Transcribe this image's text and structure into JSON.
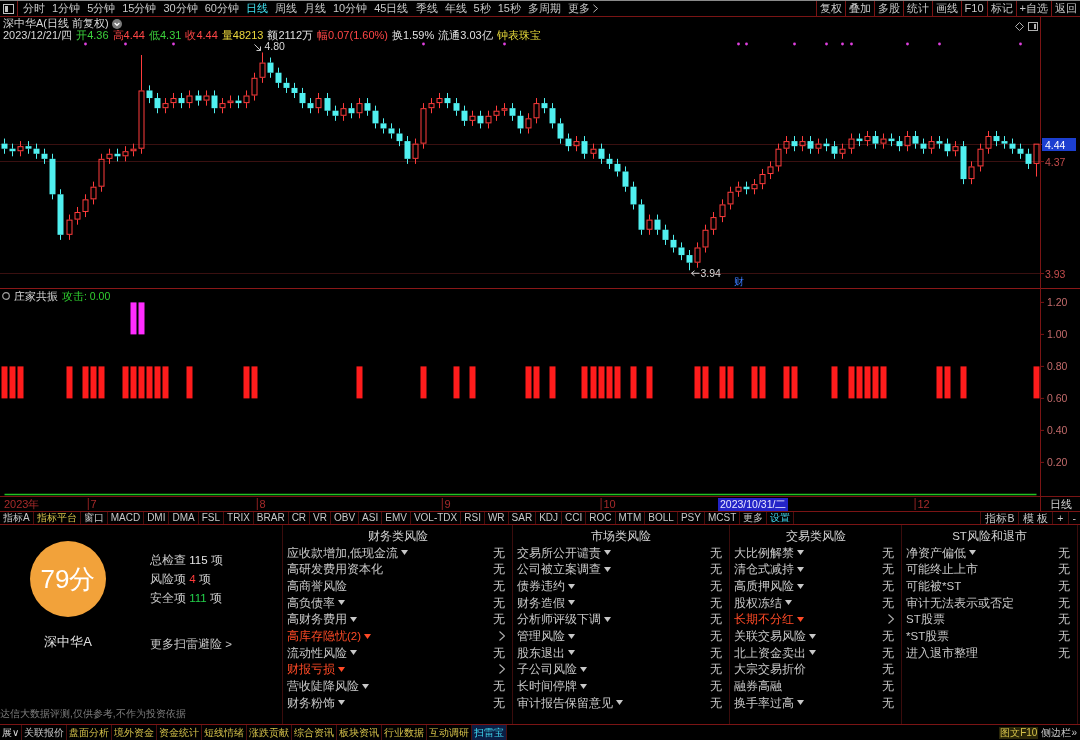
{
  "toolbar": {
    "periods": [
      {
        "label": "分时",
        "selected": false
      },
      {
        "label": "1分钟",
        "selected": false
      },
      {
        "label": "5分钟",
        "selected": false
      },
      {
        "label": "15分钟",
        "selected": false
      },
      {
        "label": "30分钟",
        "selected": false
      },
      {
        "label": "60分钟",
        "selected": false
      },
      {
        "label": "日线",
        "selected": true
      },
      {
        "label": "周线",
        "selected": false
      },
      {
        "label": "月线",
        "selected": false
      },
      {
        "label": "10分钟",
        "selected": false
      },
      {
        "label": "45日线",
        "selected": false
      },
      {
        "label": "季线",
        "selected": false
      },
      {
        "label": "年线",
        "selected": false
      },
      {
        "label": "5秒",
        "selected": false
      },
      {
        "label": "15秒",
        "selected": false
      },
      {
        "label": "多周期",
        "selected": false
      }
    ],
    "more": "更多",
    "actions": [
      "复权",
      "叠加",
      "多股",
      "统计",
      "画线",
      "F10",
      "标记",
      "+自选",
      "返回"
    ]
  },
  "quote_header": {
    "title": "深中华A(日线 前复权)",
    "date": "2023/12/21/四",
    "fields": [
      {
        "label": "开4.36",
        "kind": "down"
      },
      {
        "label": "高4.44",
        "kind": "up"
      },
      {
        "label": "低4.31",
        "kind": "down"
      },
      {
        "label": "收4.44",
        "kind": "up"
      },
      {
        "label": "量48213",
        "kind": "volume"
      },
      {
        "label": "额2112万",
        "kind": "flat"
      },
      {
        "label": "幅0.07(1.60%)",
        "kind": "up"
      },
      {
        "label": "换1.59%",
        "kind": "flat"
      },
      {
        "label": "流通3.03亿",
        "kind": "flat"
      },
      {
        "label": "钟表珠宝",
        "kind": "sector"
      }
    ]
  },
  "price_chart": {
    "chart_data": [
      {
        "type": "candlestick",
        "ohlc": [
          [
            4.44,
            4.46,
            4.4,
            4.42
          ],
          [
            4.42,
            4.44,
            4.39,
            4.41
          ],
          [
            4.41,
            4.45,
            4.39,
            4.43
          ],
          [
            4.43,
            4.45,
            4.4,
            4.42
          ],
          [
            4.42,
            4.44,
            4.38,
            4.4
          ],
          [
            4.4,
            4.42,
            4.36,
            4.38
          ],
          [
            4.38,
            4.4,
            4.22,
            4.24
          ],
          [
            4.24,
            4.26,
            4.06,
            4.08
          ],
          [
            4.08,
            4.16,
            4.06,
            4.14
          ],
          [
            4.14,
            4.19,
            4.12,
            4.17
          ],
          [
            4.17,
            4.24,
            4.15,
            4.22
          ],
          [
            4.22,
            4.29,
            4.2,
            4.27
          ],
          [
            4.27,
            4.4,
            4.25,
            4.38
          ],
          [
            4.38,
            4.42,
            4.36,
            4.4
          ],
          [
            4.4,
            4.42,
            4.37,
            4.39
          ],
          [
            4.39,
            4.43,
            4.37,
            4.41
          ],
          [
            4.41,
            4.44,
            4.39,
            4.42
          ],
          [
            4.42,
            4.79,
            4.4,
            4.65
          ],
          [
            4.65,
            4.67,
            4.6,
            4.62
          ],
          [
            4.62,
            4.64,
            4.56,
            4.58
          ],
          [
            4.58,
            4.62,
            4.56,
            4.6
          ],
          [
            4.6,
            4.64,
            4.58,
            4.62
          ],
          [
            4.62,
            4.64,
            4.58,
            4.6
          ],
          [
            4.6,
            4.65,
            4.58,
            4.63
          ],
          [
            4.63,
            4.65,
            4.59,
            4.61
          ],
          [
            4.61,
            4.65,
            4.59,
            4.63
          ],
          [
            4.63,
            4.65,
            4.56,
            4.58
          ],
          [
            4.58,
            4.62,
            4.56,
            4.6
          ],
          [
            4.6,
            4.63,
            4.58,
            4.61
          ],
          [
            4.61,
            4.63,
            4.58,
            4.6
          ],
          [
            4.6,
            4.65,
            4.58,
            4.63
          ],
          [
            4.63,
            4.72,
            4.61,
            4.7
          ],
          [
            4.7,
            4.8,
            4.68,
            4.76
          ],
          [
            4.76,
            4.78,
            4.7,
            4.72
          ],
          [
            4.72,
            4.74,
            4.66,
            4.68
          ],
          [
            4.68,
            4.7,
            4.64,
            4.66
          ],
          [
            4.66,
            4.68,
            4.62,
            4.64
          ],
          [
            4.64,
            4.66,
            4.58,
            4.6
          ],
          [
            4.6,
            4.62,
            4.56,
            4.58
          ],
          [
            4.58,
            4.64,
            4.56,
            4.62
          ],
          [
            4.62,
            4.64,
            4.55,
            4.57
          ],
          [
            4.57,
            4.59,
            4.53,
            4.55
          ],
          [
            4.55,
            4.6,
            4.53,
            4.58
          ],
          [
            4.58,
            4.6,
            4.54,
            4.56
          ],
          [
            4.56,
            4.62,
            4.54,
            4.6
          ],
          [
            4.6,
            4.62,
            4.55,
            4.57
          ],
          [
            4.57,
            4.59,
            4.5,
            4.52
          ],
          [
            4.52,
            4.54,
            4.48,
            4.5
          ],
          [
            4.5,
            4.52,
            4.46,
            4.48
          ],
          [
            4.48,
            4.5,
            4.43,
            4.45
          ],
          [
            4.45,
            4.47,
            4.36,
            4.38
          ],
          [
            4.38,
            4.46,
            4.36,
            4.44
          ],
          [
            4.44,
            4.6,
            4.42,
            4.58
          ],
          [
            4.58,
            4.62,
            4.56,
            4.6
          ],
          [
            4.6,
            4.64,
            4.58,
            4.62
          ],
          [
            4.62,
            4.64,
            4.58,
            4.6
          ],
          [
            4.6,
            4.62,
            4.55,
            4.57
          ],
          [
            4.57,
            4.59,
            4.51,
            4.53
          ],
          [
            4.53,
            4.57,
            4.51,
            4.55
          ],
          [
            4.55,
            4.57,
            4.5,
            4.52
          ],
          [
            4.52,
            4.57,
            4.5,
            4.55
          ],
          [
            4.55,
            4.59,
            4.53,
            4.57
          ],
          [
            4.57,
            4.6,
            4.55,
            4.58
          ],
          [
            4.58,
            4.6,
            4.53,
            4.55
          ],
          [
            4.55,
            4.57,
            4.48,
            4.5
          ],
          [
            4.5,
            4.56,
            4.48,
            4.54
          ],
          [
            4.54,
            4.62,
            4.52,
            4.6
          ],
          [
            4.6,
            4.62,
            4.56,
            4.58
          ],
          [
            4.58,
            4.6,
            4.5,
            4.52
          ],
          [
            4.52,
            4.54,
            4.44,
            4.46
          ],
          [
            4.46,
            4.48,
            4.41,
            4.43
          ],
          [
            4.43,
            4.47,
            4.41,
            4.45
          ],
          [
            4.45,
            4.47,
            4.38,
            4.4
          ],
          [
            4.4,
            4.44,
            4.38,
            4.42
          ],
          [
            4.42,
            4.44,
            4.36,
            4.38
          ],
          [
            4.38,
            4.4,
            4.34,
            4.36
          ],
          [
            4.36,
            4.38,
            4.31,
            4.33
          ],
          [
            4.33,
            4.35,
            4.25,
            4.27
          ],
          [
            4.27,
            4.29,
            4.18,
            4.2
          ],
          [
            4.2,
            4.22,
            4.08,
            4.1
          ],
          [
            4.1,
            4.16,
            4.08,
            4.14
          ],
          [
            4.14,
            4.16,
            4.08,
            4.1
          ],
          [
            4.1,
            4.12,
            4.04,
            4.06
          ],
          [
            4.06,
            4.08,
            4.01,
            4.03
          ],
          [
            4.03,
            4.05,
            3.98,
            4.0
          ],
          [
            4.0,
            4.02,
            3.94,
            3.97
          ],
          [
            3.97,
            4.05,
            3.95,
            4.03
          ],
          [
            4.03,
            4.12,
            4.01,
            4.1
          ],
          [
            4.1,
            4.17,
            4.08,
            4.15
          ],
          [
            4.15,
            4.22,
            4.13,
            4.2
          ],
          [
            4.2,
            4.27,
            4.18,
            4.25
          ],
          [
            4.25,
            4.29,
            4.23,
            4.27
          ],
          [
            4.27,
            4.29,
            4.24,
            4.26
          ],
          [
            4.26,
            4.3,
            4.24,
            4.28
          ],
          [
            4.28,
            4.34,
            4.26,
            4.32
          ],
          [
            4.32,
            4.37,
            4.3,
            4.35
          ],
          [
            4.35,
            4.44,
            4.33,
            4.42
          ],
          [
            4.42,
            4.47,
            4.4,
            4.45
          ],
          [
            4.45,
            4.47,
            4.41,
            4.43
          ],
          [
            4.43,
            4.47,
            4.41,
            4.45
          ],
          [
            4.45,
            4.47,
            4.4,
            4.42
          ],
          [
            4.42,
            4.46,
            4.4,
            4.44
          ],
          [
            4.44,
            4.46,
            4.41,
            4.43
          ],
          [
            4.43,
            4.45,
            4.38,
            4.4
          ],
          [
            4.4,
            4.44,
            4.38,
            4.42
          ],
          [
            4.42,
            4.48,
            4.4,
            4.46
          ],
          [
            4.46,
            4.48,
            4.43,
            4.45
          ],
          [
            4.45,
            4.49,
            4.43,
            4.47
          ],
          [
            4.47,
            4.49,
            4.42,
            4.44
          ],
          [
            4.44,
            4.48,
            4.42,
            4.46
          ],
          [
            4.46,
            4.48,
            4.43,
            4.45
          ],
          [
            4.45,
            4.47,
            4.41,
            4.43
          ],
          [
            4.43,
            4.49,
            4.41,
            4.47
          ],
          [
            4.47,
            4.49,
            4.42,
            4.44
          ],
          [
            4.44,
            4.46,
            4.4,
            4.42
          ],
          [
            4.42,
            4.47,
            4.4,
            4.45
          ],
          [
            4.45,
            4.47,
            4.42,
            4.44
          ],
          [
            4.44,
            4.46,
            4.39,
            4.41
          ],
          [
            4.41,
            4.45,
            4.39,
            4.43
          ],
          [
            4.43,
            4.45,
            4.28,
            4.3
          ],
          [
            4.3,
            4.37,
            4.28,
            4.35
          ],
          [
            4.35,
            4.44,
            4.33,
            4.42
          ],
          [
            4.42,
            4.49,
            4.4,
            4.47
          ],
          [
            4.47,
            4.49,
            4.43,
            4.45
          ],
          [
            4.45,
            4.47,
            4.42,
            4.44
          ],
          [
            4.44,
            4.46,
            4.4,
            4.42
          ],
          [
            4.42,
            4.44,
            4.38,
            4.4
          ],
          [
            4.4,
            4.42,
            4.34,
            4.36
          ],
          [
            4.36,
            4.44,
            4.31,
            4.44
          ]
        ],
        "ylim": [
          3.87,
          4.94
        ],
        "yticks": [
          3.93,
          4.37,
          4.44
        ],
        "tick_labels": "y",
        "grid": true,
        "annotations": [
          "4.80",
          "3.94",
          "财"
        ]
      }
    ]
  },
  "indicator_panel": {
    "name": "庄家共振",
    "readout": "攻击: 0.00",
    "chart_data": [
      {
        "type": "bar",
        "categories": [
          null,
          null,
          null,
          null,
          null,
          null,
          null,
          null,
          null,
          null,
          null,
          "7",
          null,
          null,
          null,
          null,
          null,
          null,
          null,
          null,
          null,
          null,
          null,
          null,
          null,
          null,
          null,
          null,
          null,
          null,
          null,
          null,
          "8",
          null,
          null,
          null,
          null,
          null,
          null,
          null,
          null,
          null,
          null,
          null,
          null,
          null,
          null,
          null,
          null,
          null,
          null,
          null,
          null,
          null,
          null,
          "9",
          null,
          null,
          null,
          null,
          null,
          null,
          null,
          null,
          null,
          null,
          null,
          null,
          null,
          null,
          null,
          null,
          null,
          null,
          null,
          "10",
          null,
          null,
          null,
          null,
          null,
          null,
          null,
          null,
          null,
          null,
          null,
          null,
          null,
          null,
          null,
          null,
          null,
          null,
          null,
          null,
          null,
          null,
          null,
          null,
          null,
          null,
          null,
          null,
          null,
          null,
          null,
          null,
          null,
          null,
          null,
          null,
          null,
          null,
          "12",
          null,
          null,
          null,
          null,
          null,
          null,
          null,
          null,
          null,
          null,
          null,
          null,
          null,
          null
        ],
        "series": [
          {
            "color": "#ff1c1c",
            "values": [
              0.2,
              0.2,
              0.2,
              null,
              null,
              null,
              null,
              null,
              0.2,
              null,
              0.2,
              0.2,
              0.2,
              null,
              null,
              0.2,
              0.2,
              0.2,
              0.2,
              0.2,
              0.2,
              null,
              null,
              0.2,
              null,
              null,
              null,
              null,
              null,
              null,
              0.2,
              0.2,
              null,
              null,
              null,
              null,
              null,
              null,
              null,
              null,
              null,
              null,
              null,
              null,
              0.2,
              null,
              null,
              null,
              null,
              null,
              null,
              null,
              0.2,
              null,
              null,
              null,
              0.2,
              null,
              0.2,
              null,
              null,
              null,
              null,
              null,
              null,
              0.2,
              0.2,
              null,
              0.2,
              null,
              null,
              null,
              0.2,
              0.2,
              0.2,
              0.2,
              0.2,
              null,
              0.2,
              null,
              0.2,
              null,
              null,
              null,
              null,
              null,
              0.2,
              0.2,
              null,
              0.2,
              0.2,
              null,
              null,
              0.2,
              0.2,
              null,
              null,
              0.2,
              0.2,
              null,
              null,
              null,
              null,
              0.2,
              null,
              0.2,
              0.2,
              0.2,
              0.2,
              0.2,
              null,
              null,
              null,
              null,
              null,
              null,
              0.2,
              0.2,
              null,
              0.2,
              null,
              null,
              null,
              null,
              null,
              null,
              null,
              null,
              0.2
            ],
            "base": [
              0.6,
              0.6,
              0.6,
              null,
              null,
              null,
              null,
              null,
              0.6,
              null,
              0.6,
              0.6,
              0.6,
              null,
              null,
              0.6,
              0.6,
              0.6,
              0.6,
              0.6,
              0.6,
              null,
              null,
              0.6,
              null,
              null,
              null,
              null,
              null,
              null,
              0.6,
              0.6,
              null,
              null,
              null,
              null,
              null,
              null,
              null,
              null,
              null,
              null,
              null,
              null,
              0.6,
              null,
              null,
              null,
              null,
              null,
              null,
              null,
              0.6,
              null,
              null,
              null,
              0.6,
              null,
              0.6,
              null,
              null,
              null,
              null,
              null,
              null,
              0.6,
              0.6,
              null,
              0.6,
              null,
              null,
              null,
              0.6,
              0.6,
              0.6,
              0.6,
              0.6,
              null,
              0.6,
              null,
              0.6,
              null,
              null,
              null,
              null,
              null,
              0.6,
              0.6,
              null,
              0.6,
              0.6,
              null,
              null,
              0.6,
              0.6,
              null,
              null,
              0.6,
              0.6,
              null,
              null,
              null,
              null,
              0.6,
              null,
              0.6,
              0.6,
              0.6,
              0.6,
              0.6,
              null,
              null,
              null,
              null,
              null,
              null,
              0.6,
              0.6,
              null,
              0.6,
              null,
              null,
              null,
              null,
              null,
              null,
              null,
              null,
              0.6
            ]
          },
          {
            "color": "#ff2cff",
            "values": [
              null,
              null,
              null,
              null,
              null,
              null,
              null,
              null,
              null,
              null,
              null,
              null,
              null,
              null,
              null,
              null,
              0.2,
              0.2,
              null,
              null,
              null,
              null,
              null,
              null,
              null,
              null,
              null,
              null,
              null,
              null,
              null,
              null,
              null,
              null,
              null,
              null,
              null,
              null,
              null,
              null,
              null,
              null,
              null,
              null,
              null,
              null,
              null,
              null,
              null,
              null,
              null,
              null,
              null,
              null,
              null,
              null,
              null,
              null,
              null,
              null,
              null,
              null,
              null,
              null,
              null,
              null,
              null,
              null,
              null,
              null,
              null,
              null,
              null,
              null,
              null,
              null,
              null,
              null,
              null,
              null,
              null,
              null,
              null,
              null,
              null,
              null,
              null,
              null,
              null,
              null,
              null,
              null,
              null,
              null,
              null,
              null,
              null,
              null,
              null,
              null,
              null,
              null,
              null,
              null,
              null,
              null,
              null,
              null,
              null,
              null,
              null,
              null,
              null,
              null,
              null,
              null,
              null,
              null,
              null,
              null,
              null,
              null,
              null,
              null,
              null,
              null,
              null,
              null,
              null
            ],
            "base": [
              null,
              null,
              null,
              null,
              null,
              null,
              null,
              null,
              null,
              null,
              null,
              null,
              null,
              null,
              null,
              null,
              1.0,
              1.0,
              null,
              null,
              null,
              null,
              null,
              null,
              null,
              null,
              null,
              null,
              null,
              null,
              null,
              null,
              null,
              null,
              null,
              null,
              null,
              null,
              null,
              null,
              null,
              null,
              null,
              null,
              null,
              null,
              null,
              null,
              null,
              null,
              null,
              null,
              null,
              null,
              null,
              null,
              null,
              null,
              null,
              null,
              null,
              null,
              null,
              null,
              null,
              null,
              null,
              null,
              null,
              null,
              null,
              null,
              null,
              null,
              null,
              null,
              null,
              null,
              null,
              null,
              null,
              null,
              null,
              null,
              null,
              null,
              null,
              null,
              null,
              null,
              null,
              null,
              null,
              null,
              null,
              null,
              null,
              null,
              null,
              null,
              null,
              null,
              null,
              null,
              null,
              null,
              null,
              null,
              null,
              null,
              null,
              null,
              null,
              null,
              null,
              null,
              null,
              null,
              null,
              null,
              null,
              null,
              null,
              null,
              null,
              null,
              null,
              null,
              null
            ]
          },
          {
            "type": "line",
            "color": "#22c222",
            "values": [
              0,
              0,
              0,
              0,
              0,
              0,
              0,
              0,
              0,
              0,
              0,
              0,
              0,
              0,
              0,
              0,
              0,
              0,
              0,
              0,
              0,
              0,
              0,
              0,
              0,
              0,
              0,
              0,
              0,
              0,
              0,
              0,
              0,
              0,
              0,
              0,
              0,
              0,
              0,
              0,
              0,
              0,
              0,
              0,
              0,
              0,
              0,
              0,
              0,
              0,
              0,
              0,
              0,
              0,
              0,
              0,
              0,
              0,
              0,
              0,
              0,
              0,
              0,
              0,
              0,
              0,
              0,
              0,
              0,
              0,
              0,
              0,
              0,
              0,
              0,
              0,
              0,
              0,
              0,
              0,
              0,
              0,
              0,
              0,
              0,
              0,
              0,
              0,
              0,
              0,
              0,
              0,
              0,
              0,
              0,
              0,
              0,
              0,
              0,
              0,
              0,
              0,
              0,
              0,
              0,
              0,
              0,
              0,
              0,
              0,
              0,
              0,
              0,
              0,
              0,
              0,
              0,
              0,
              0,
              0,
              0,
              0,
              0,
              0,
              0,
              0,
              0,
              0,
              0
            ]
          }
        ],
        "ylim": [
          -0.01,
          1.29
        ],
        "yticks": [
          {
            "value": 0.2,
            "label": "0.20"
          },
          {
            "value": 0.4,
            "label": "0.40"
          },
          {
            "value": 0.6,
            "label": "0.60"
          },
          {
            "value": 0.8,
            "label": "0.80"
          },
          {
            "value": 1.0,
            "label": "1.00"
          },
          {
            "value": 1.2,
            "label": "1.20"
          }
        ]
      }
    ]
  },
  "x_axis": {
    "year_label": "2023年",
    "cursor_date": "2023/10/31/二",
    "period": "日线"
  },
  "indicator_tabs": {
    "left": [
      {
        "label": "指标A",
        "kind": "plain"
      },
      {
        "label": "指标平台",
        "kind": "feature"
      },
      {
        "label": "窗口",
        "kind": "plain"
      },
      {
        "label": "MACD",
        "kind": "plain"
      },
      {
        "label": "DMI",
        "kind": "plain"
      },
      {
        "label": "DMA",
        "kind": "plain"
      },
      {
        "label": "FSL",
        "kind": "plain"
      },
      {
        "label": "TRIX",
        "kind": "plain"
      },
      {
        "label": "BRAR",
        "kind": "plain"
      },
      {
        "label": "CR",
        "kind": "plain"
      },
      {
        "label": "VR",
        "kind": "plain"
      },
      {
        "label": "OBV",
        "kind": "plain"
      },
      {
        "label": "ASI",
        "kind": "plain"
      },
      {
        "label": "EMV",
        "kind": "plain"
      },
      {
        "label": "VOL-TDX",
        "kind": "plain"
      },
      {
        "label": "RSI",
        "kind": "plain"
      },
      {
        "label": "WR",
        "kind": "plain"
      },
      {
        "label": "SAR",
        "kind": "plain"
      },
      {
        "label": "KDJ",
        "kind": "plain"
      },
      {
        "label": "CCI",
        "kind": "plain"
      },
      {
        "label": "ROC",
        "kind": "plain"
      },
      {
        "label": "MTM",
        "kind": "plain"
      },
      {
        "label": "BOLL",
        "kind": "plain"
      },
      {
        "label": "PSY",
        "kind": "plain"
      },
      {
        "label": "MCST",
        "kind": "plain"
      },
      {
        "label": "更多",
        "kind": "plain"
      },
      {
        "label": "设置",
        "kind": "accent"
      }
    ],
    "right": [
      "指标B",
      "模 板",
      "+",
      "-"
    ]
  },
  "risk_scan": {
    "score": "79分",
    "stock": "深中华A",
    "stats": [
      {
        "label": "总检查",
        "count": "115",
        "unit": "项",
        "kind": "total"
      },
      {
        "label": "风险项",
        "count": "4",
        "unit": "项",
        "kind": "risk"
      },
      {
        "label": "安全项",
        "count": "111",
        "unit": "项",
        "kind": "safe"
      }
    ],
    "more_link": "更多扫雷避险 >",
    "disclaimer": "达信大数据评测,仅供参考,不作为投资依据",
    "columns": [
      {
        "title": "财务类风险",
        "items": [
          {
            "label": "应收款增加,低现金流",
            "menu": true,
            "flagged": false,
            "value": "无"
          },
          {
            "label": "高研发费用资本化",
            "menu": false,
            "flagged": false,
            "value": "无"
          },
          {
            "label": "高商誉风险",
            "menu": false,
            "flagged": false,
            "value": "无"
          },
          {
            "label": "高负债率",
            "menu": true,
            "flagged": false,
            "value": "无"
          },
          {
            "label": "高财务费用",
            "menu": true,
            "flagged": false,
            "value": "无"
          },
          {
            "label": "高库存隐忧(2)",
            "menu": true,
            "flagged": true
          },
          {
            "label": "流动性风险",
            "menu": true,
            "flagged": false,
            "value": "无"
          },
          {
            "label": "财报亏损",
            "menu": true,
            "flagged": true
          },
          {
            "label": "营收陡降风险",
            "menu": true,
            "flagged": false,
            "value": "无"
          },
          {
            "label": "财务粉饰",
            "menu": true,
            "flagged": false,
            "value": "无"
          }
        ]
      },
      {
        "title": "市场类风险",
        "items": [
          {
            "label": "交易所公开谴责",
            "menu": true,
            "flagged": false,
            "value": "无"
          },
          {
            "label": "公司被立案调查",
            "menu": true,
            "flagged": false,
            "value": "无"
          },
          {
            "label": "债券违约",
            "menu": true,
            "flagged": false,
            "value": "无"
          },
          {
            "label": "财务造假",
            "menu": true,
            "flagged": false,
            "value": "无"
          },
          {
            "label": "分析师评级下调",
            "menu": true,
            "flagged": false,
            "value": "无"
          },
          {
            "label": "管理风险",
            "menu": true,
            "flagged": false,
            "value": "无"
          },
          {
            "label": "股东退出",
            "menu": true,
            "flagged": false,
            "value": "无"
          },
          {
            "label": "子公司风险",
            "menu": true,
            "flagged": false,
            "value": "无"
          },
          {
            "label": "长时间停牌",
            "menu": true,
            "flagged": false,
            "value": "无"
          },
          {
            "label": "审计报告保留意见",
            "menu": true,
            "flagged": false,
            "value": "无"
          }
        ]
      },
      {
        "title": "交易类风险",
        "items": [
          {
            "label": "大比例解禁",
            "menu": true,
            "flagged": false,
            "value": "无"
          },
          {
            "label": "清仓式减持",
            "menu": true,
            "flagged": false,
            "value": "无"
          },
          {
            "label": "高质押风险",
            "menu": true,
            "flagged": false,
            "value": "无"
          },
          {
            "label": "股权冻结",
            "menu": true,
            "flagged": false,
            "value": "无"
          },
          {
            "label": "长期不分红",
            "menu": true,
            "flagged": true
          },
          {
            "label": "关联交易风险",
            "menu": true,
            "flagged": false,
            "value": "无"
          },
          {
            "label": "北上资金卖出",
            "menu": true,
            "flagged": false,
            "value": "无"
          },
          {
            "label": "大宗交易折价",
            "menu": false,
            "flagged": false,
            "value": "无"
          },
          {
            "label": "融券高融",
            "menu": false,
            "flagged": false,
            "value": "无"
          },
          {
            "label": "换手率过高",
            "menu": true,
            "flagged": false,
            "value": "无"
          }
        ]
      },
      {
        "title": "ST风险和退市",
        "items": [
          {
            "label": "净资产偏低",
            "menu": true,
            "flagged": false,
            "value": "无"
          },
          {
            "label": "可能终止上市",
            "menu": false,
            "flagged": false,
            "value": "无"
          },
          {
            "label": "可能被*ST",
            "menu": false,
            "flagged": false,
            "value": "无"
          },
          {
            "label": "审计无法表示或否定",
            "menu": false,
            "flagged": false,
            "value": "无"
          },
          {
            "label": "ST股票",
            "menu": false,
            "flagged": false,
            "value": "无"
          },
          {
            "label": "*ST股票",
            "menu": false,
            "flagged": false,
            "value": "无"
          },
          {
            "label": "进入退市整理",
            "menu": false,
            "flagged": false,
            "value": "无"
          }
        ]
      }
    ]
  },
  "bottom_tabs": [
    {
      "label": "展∨",
      "kind": "toggle",
      "selected": false
    },
    {
      "label": "关联报价",
      "kind": "plain",
      "selected": false
    },
    {
      "label": "盘面分析",
      "kind": "feature",
      "selected": false
    },
    {
      "label": "境外资金",
      "kind": "feature",
      "selected": false
    },
    {
      "label": "资金统计",
      "kind": "feature",
      "selected": false
    },
    {
      "label": "短线情绪",
      "kind": "feature",
      "selected": false
    },
    {
      "label": "涨跌贡献",
      "kind": "feature",
      "selected": false
    },
    {
      "label": "综合资讯",
      "kind": "feature",
      "selected": false
    },
    {
      "label": "板块资讯",
      "kind": "feature",
      "selected": false
    },
    {
      "label": "行业数据",
      "kind": "feature",
      "selected": false
    },
    {
      "label": "互动调研",
      "kind": "feature",
      "selected": false
    },
    {
      "label": "扫雷宝",
      "kind": "feature",
      "selected": true
    }
  ],
  "side_links": [
    {
      "label": "图文F10",
      "kind": "feature"
    },
    {
      "label": "侧边栏»",
      "kind": "plain"
    }
  ]
}
